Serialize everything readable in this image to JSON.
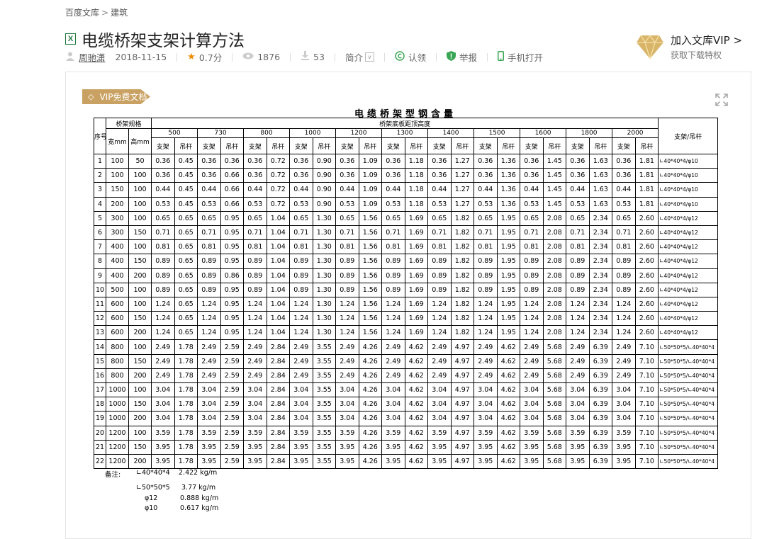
{
  "breadcrumb": {
    "root": "百度文库",
    "sep": ">",
    "category": "建筑"
  },
  "doc": {
    "icon_label": "X",
    "title": "电缆桥架支架计算方法"
  },
  "meta": {
    "author": "周驰潇",
    "date": "2018-11-15",
    "score": "0.7分",
    "views": "1876",
    "downloads": "53",
    "intro": "简介",
    "claim": "认领",
    "report": "举报",
    "mobile": "手机打开"
  },
  "vip_promo": {
    "title": "加入文库VIP >",
    "subtitle": "获取下载特权"
  },
  "vip_badge": "VIP免费文档",
  "sheet": {
    "title": "电缆桥架型钢含量",
    "col_no": "序号",
    "col_spec": "桥架规格",
    "col_width": "宽mm",
    "col_height": "高mm",
    "col_span_title": "桥架底板距顶高度",
    "col_last": "支架/吊杆",
    "heights": [
      "500",
      "730",
      "800",
      "1000",
      "1200",
      "1300",
      "1400",
      "1500",
      "1600",
      "1800",
      "2000"
    ],
    "sub_a": "支架",
    "sub_b": "吊杆",
    "rows": [
      {
        "no": "1",
        "w": "100",
        "h": "50",
        "v": [
          "0.36",
          "0.45",
          "0.36",
          "0.36",
          "0.36",
          "0.72",
          "0.36",
          "0.90",
          "0.36",
          "1.09",
          "0.36",
          "1.18",
          "0.36",
          "1.27",
          "0.36",
          "1.36",
          "0.36",
          "1.45",
          "0.36",
          "1.63",
          "0.36",
          "1.81"
        ],
        "note": "∟40*40*4/φ10"
      },
      {
        "no": "2",
        "w": "100",
        "h": "100",
        "v": [
          "0.36",
          "0.45",
          "0.36",
          "0.66",
          "0.36",
          "0.72",
          "0.36",
          "0.90",
          "0.36",
          "1.09",
          "0.36",
          "1.18",
          "0.36",
          "1.27",
          "0.36",
          "1.36",
          "0.36",
          "1.45",
          "0.36",
          "1.63",
          "0.36",
          "1.81"
        ],
        "note": "∟40*40*4/φ10"
      },
      {
        "no": "3",
        "w": "150",
        "h": "100",
        "v": [
          "0.44",
          "0.45",
          "0.44",
          "0.66",
          "0.44",
          "0.72",
          "0.44",
          "0.90",
          "0.44",
          "1.09",
          "0.44",
          "1.18",
          "0.44",
          "1.27",
          "0.44",
          "1.36",
          "0.44",
          "1.45",
          "0.44",
          "1.63",
          "0.44",
          "1.81"
        ],
        "note": "∟40*40*4/φ10"
      },
      {
        "no": "4",
        "w": "200",
        "h": "100",
        "v": [
          "0.53",
          "0.45",
          "0.53",
          "0.66",
          "0.53",
          "0.72",
          "0.53",
          "0.90",
          "0.53",
          "1.09",
          "0.53",
          "1.18",
          "0.53",
          "1.27",
          "0.53",
          "1.36",
          "0.53",
          "1.45",
          "0.53",
          "1.63",
          "0.53",
          "1.81"
        ],
        "note": "∟40*40*4/φ10"
      },
      {
        "no": "5",
        "w": "300",
        "h": "100",
        "v": [
          "0.65",
          "0.65",
          "0.65",
          "0.95",
          "0.65",
          "1.04",
          "0.65",
          "1.30",
          "0.65",
          "1.56",
          "0.65",
          "1.69",
          "0.65",
          "1.82",
          "0.65",
          "1.95",
          "0.65",
          "2.08",
          "0.65",
          "2.34",
          "0.65",
          "2.60"
        ],
        "note": "∟40*40*4/φ12"
      },
      {
        "no": "6",
        "w": "300",
        "h": "150",
        "v": [
          "0.71",
          "0.65",
          "0.71",
          "0.95",
          "0.71",
          "1.04",
          "0.71",
          "1.30",
          "0.71",
          "1.56",
          "0.71",
          "1.69",
          "0.71",
          "1.82",
          "0.71",
          "1.95",
          "0.71",
          "2.08",
          "0.71",
          "2.34",
          "0.71",
          "2.60"
        ],
        "note": "∟40*40*4/φ12"
      },
      {
        "no": "7",
        "w": "400",
        "h": "100",
        "v": [
          "0.81",
          "0.65",
          "0.81",
          "0.95",
          "0.81",
          "1.04",
          "0.81",
          "1.30",
          "0.81",
          "1.56",
          "0.81",
          "1.69",
          "0.81",
          "1.82",
          "0.81",
          "1.95",
          "0.81",
          "2.08",
          "0.81",
          "2.34",
          "0.81",
          "2.60"
        ],
        "note": "∟40*40*4/φ12"
      },
      {
        "no": "8",
        "w": "400",
        "h": "150",
        "v": [
          "0.89",
          "0.65",
          "0.89",
          "0.95",
          "0.89",
          "1.04",
          "0.89",
          "1.30",
          "0.89",
          "1.56",
          "0.89",
          "1.69",
          "0.89",
          "1.82",
          "0.89",
          "1.95",
          "0.89",
          "2.08",
          "0.89",
          "2.34",
          "0.89",
          "2.60"
        ],
        "note": "∟40*40*4/φ12"
      },
      {
        "no": "9",
        "w": "400",
        "h": "200",
        "v": [
          "0.89",
          "0.65",
          "0.89",
          "0.86",
          "0.89",
          "1.04",
          "0.89",
          "1.30",
          "0.89",
          "1.56",
          "0.89",
          "1.69",
          "0.89",
          "1.82",
          "0.89",
          "1.95",
          "0.89",
          "2.08",
          "0.89",
          "2.34",
          "0.89",
          "2.60"
        ],
        "note": "∟40*40*4/φ12"
      },
      {
        "no": "10",
        "w": "500",
        "h": "100",
        "v": [
          "0.89",
          "0.65",
          "0.89",
          "0.95",
          "0.89",
          "1.04",
          "0.89",
          "1.30",
          "0.89",
          "1.56",
          "0.89",
          "1.69",
          "0.89",
          "1.82",
          "0.89",
          "1.95",
          "0.89",
          "2.08",
          "0.89",
          "2.34",
          "0.89",
          "2.60"
        ],
        "note": "∟40*40*4/φ12"
      },
      {
        "no": "11",
        "w": "600",
        "h": "100",
        "v": [
          "1.24",
          "0.65",
          "1.24",
          "0.95",
          "1.24",
          "1.04",
          "1.24",
          "1.30",
          "1.24",
          "1.56",
          "1.24",
          "1.69",
          "1.24",
          "1.82",
          "1.24",
          "1.95",
          "1.24",
          "2.08",
          "1.24",
          "2.34",
          "1.24",
          "2.60"
        ],
        "note": "∟40*40*4/φ12"
      },
      {
        "no": "12",
        "w": "600",
        "h": "150",
        "v": [
          "1.24",
          "0.65",
          "1.24",
          "0.95",
          "1.24",
          "1.04",
          "1.24",
          "1.30",
          "1.24",
          "1.56",
          "1.24",
          "1.69",
          "1.24",
          "1.82",
          "1.24",
          "1.95",
          "1.24",
          "2.08",
          "1.24",
          "2.34",
          "1.24",
          "2.60"
        ],
        "note": "∟40*40*4/φ12"
      },
      {
        "no": "13",
        "w": "600",
        "h": "200",
        "v": [
          "1.24",
          "0.65",
          "1.24",
          "0.95",
          "1.24",
          "1.04",
          "1.24",
          "1.30",
          "1.24",
          "1.56",
          "1.24",
          "1.69",
          "1.24",
          "1.82",
          "1.24",
          "1.95",
          "1.24",
          "2.08",
          "1.24",
          "2.34",
          "1.24",
          "2.60"
        ],
        "note": "∟40*40*4/φ12"
      },
      {
        "no": "14",
        "w": "800",
        "h": "100",
        "v": [
          "2.49",
          "1.78",
          "2.49",
          "2.59",
          "2.49",
          "2.84",
          "2.49",
          "3.55",
          "2.49",
          "4.26",
          "2.49",
          "4.62",
          "2.49",
          "4.97",
          "2.49",
          "4.62",
          "2.49",
          "5.68",
          "2.49",
          "6.39",
          "2.49",
          "7.10"
        ],
        "note": "∟50*50*5/∟40*40*4"
      },
      {
        "no": "15",
        "w": "800",
        "h": "150",
        "v": [
          "2.49",
          "1.78",
          "2.49",
          "2.59",
          "2.49",
          "2.84",
          "2.49",
          "3.55",
          "2.49",
          "4.26",
          "2.49",
          "4.62",
          "2.49",
          "4.97",
          "2.49",
          "4.62",
          "2.49",
          "5.68",
          "2.49",
          "6.39",
          "2.49",
          "7.10"
        ],
        "note": "∟50*50*5/∟40*40*4"
      },
      {
        "no": "16",
        "w": "800",
        "h": "200",
        "v": [
          "2.49",
          "1.78",
          "2.49",
          "2.59",
          "2.49",
          "2.84",
          "2.49",
          "3.55",
          "2.49",
          "4.26",
          "2.49",
          "4.62",
          "2.49",
          "4.97",
          "2.49",
          "4.62",
          "2.49",
          "5.68",
          "2.49",
          "6.39",
          "2.49",
          "7.10"
        ],
        "note": "∟50*50*5/∟40*40*4"
      },
      {
        "no": "17",
        "w": "1000",
        "h": "100",
        "v": [
          "3.04",
          "1.78",
          "3.04",
          "2.59",
          "3.04",
          "2.84",
          "3.04",
          "3.55",
          "3.04",
          "4.26",
          "3.04",
          "4.62",
          "3.04",
          "4.97",
          "3.04",
          "4.62",
          "3.04",
          "5.68",
          "3.04",
          "6.39",
          "3.04",
          "7.10"
        ],
        "note": "∟50*50*5/∟40*40*4"
      },
      {
        "no": "18",
        "w": "1000",
        "h": "150",
        "v": [
          "3.04",
          "1.78",
          "3.04",
          "2.59",
          "3.04",
          "2.84",
          "3.04",
          "3.55",
          "3.04",
          "4.26",
          "3.04",
          "4.62",
          "3.04",
          "4.97",
          "3.04",
          "4.62",
          "3.04",
          "5.68",
          "3.04",
          "6.39",
          "3.04",
          "7.10"
        ],
        "note": "∟50*50*5/∟40*40*4"
      },
      {
        "no": "19",
        "w": "1000",
        "h": "200",
        "v": [
          "3.04",
          "1.78",
          "3.04",
          "2.59",
          "3.04",
          "2.84",
          "3.04",
          "3.55",
          "3.04",
          "4.26",
          "3.04",
          "4.62",
          "3.04",
          "4.97",
          "3.04",
          "4.62",
          "3.04",
          "5.68",
          "3.04",
          "6.39",
          "3.04",
          "7.10"
        ],
        "note": "∟50*50*5/∟40*40*4"
      },
      {
        "no": "20",
        "w": "1200",
        "h": "100",
        "v": [
          "3.59",
          "1.78",
          "3.59",
          "2.59",
          "3.59",
          "2.84",
          "3.59",
          "3.55",
          "3.59",
          "4.26",
          "3.59",
          "4.62",
          "3.59",
          "4.97",
          "3.59",
          "4.62",
          "3.59",
          "5.68",
          "3.59",
          "6.39",
          "3.59",
          "7.10"
        ],
        "note": "∟50*50*5/∟40*40*4"
      },
      {
        "no": "21",
        "w": "1200",
        "h": "150",
        "v": [
          "3.95",
          "1.78",
          "3.95",
          "2.59",
          "3.95",
          "2.84",
          "3.95",
          "3.55",
          "3.95",
          "4.26",
          "3.95",
          "4.62",
          "3.95",
          "4.97",
          "3.95",
          "4.62",
          "3.95",
          "5.68",
          "3.95",
          "6.39",
          "3.95",
          "7.10"
        ],
        "note": "∟50*50*5/∟40*40*4"
      },
      {
        "no": "22",
        "w": "1200",
        "h": "200",
        "v": [
          "3.95",
          "1.78",
          "3.95",
          "2.59",
          "3.95",
          "2.84",
          "3.95",
          "3.55",
          "3.95",
          "4.26",
          "3.95",
          "4.62",
          "3.95",
          "4.97",
          "3.95",
          "4.62",
          "3.95",
          "5.68",
          "3.95",
          "6.39",
          "3.95",
          "7.10"
        ],
        "note": "∟50*50*5/∟40*40*4"
      }
    ]
  },
  "notes": {
    "label": "备注:",
    "items": [
      {
        "name": "∟40*40*4",
        "value": "2.422 kg/m"
      },
      {
        "name": "∟50*50*5",
        "value": "3.77 kg/m"
      },
      {
        "name": "φ12",
        "value": "0.888 kg/m"
      },
      {
        "name": "φ10",
        "value": "0.617 kg/m"
      }
    ]
  },
  "colors": {
    "accent_gold": "#c9a263",
    "excel_green": "#1e7a3c",
    "star": "#f08c00"
  }
}
